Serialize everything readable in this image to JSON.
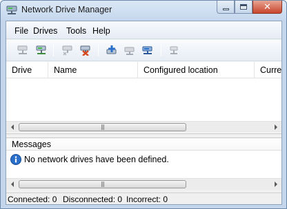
{
  "window": {
    "title": "Network Drive Manager",
    "icon": "network-drive-icon"
  },
  "menu": [
    {
      "label": "File"
    },
    {
      "label": "Drives"
    },
    {
      "label": "Tools"
    },
    {
      "label": "Help"
    }
  ],
  "toolbar": {
    "buttons": [
      {
        "icon": "connect-drive-icon",
        "enabled": false
      },
      {
        "icon": "connect-all-icon",
        "enabled": true
      },
      {
        "icon": "disconnect-drive-icon",
        "enabled": false
      },
      {
        "icon": "disconnect-all-icon",
        "enabled": true
      },
      {
        "icon": "add-drive-icon",
        "enabled": true
      },
      {
        "icon": "remove-drive-icon",
        "enabled": false
      },
      {
        "icon": "edit-drive-icon",
        "enabled": true
      },
      {
        "icon": "drive-properties-icon",
        "enabled": false
      }
    ]
  },
  "drives_table": {
    "columns": [
      "Drive",
      "Name",
      "Configured location",
      "Curre"
    ],
    "rows": []
  },
  "messages": {
    "header": "Messages",
    "items": [
      {
        "icon": "info-icon",
        "text": "No network drives have been defined."
      }
    ]
  },
  "status": {
    "connected": "Connected: 0",
    "disconnected": "Disconnected: 0",
    "incorrect": "Incorrect: 0"
  },
  "colors": {
    "accent": "#2a6fc9",
    "close_button": "#c9452b",
    "frame": "#c4d6ec"
  }
}
